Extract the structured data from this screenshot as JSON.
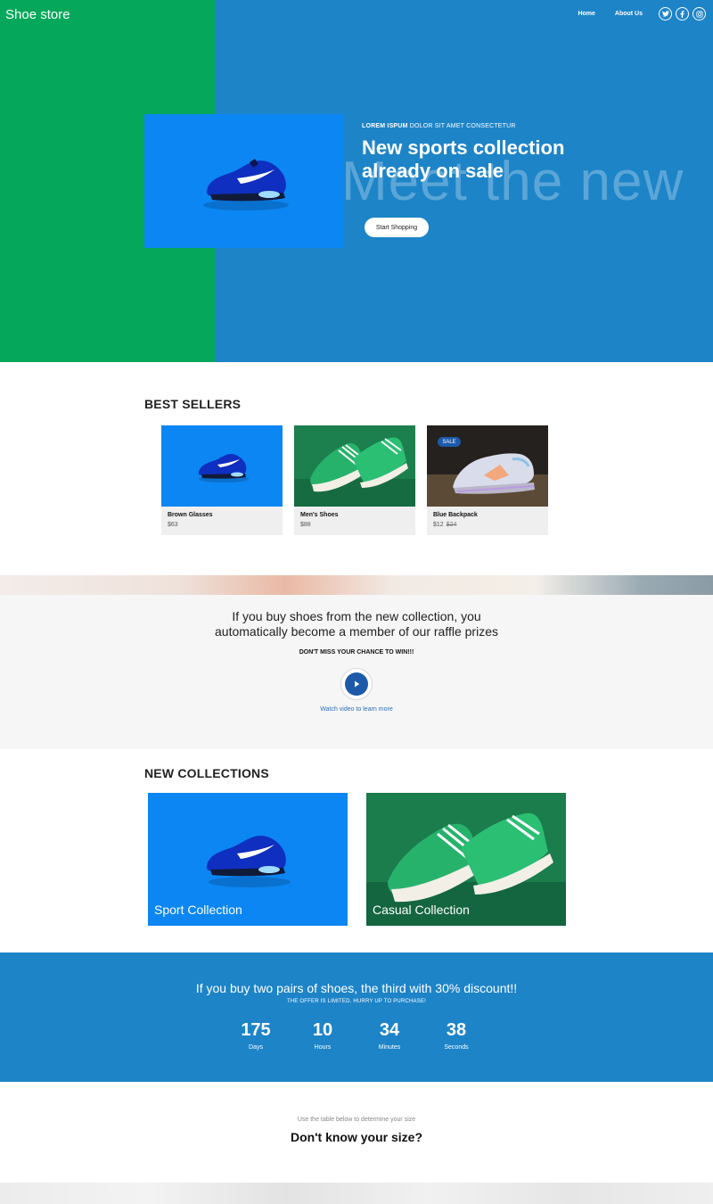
{
  "header": {
    "brand": "Shoe store",
    "nav": [
      "Home",
      "About Us"
    ],
    "social_icons": [
      "twitter-icon",
      "facebook-icon",
      "instagram-icon"
    ]
  },
  "hero": {
    "eyebrow_bold": "LOREM ISPUM",
    "eyebrow_rest": "DOLOR SIT AMET CONSECTETUR",
    "title": "New sports collection already on sale",
    "background_word": "Meet the new",
    "button": "Start Shopping"
  },
  "best_sellers": {
    "title": "BEST SELLERS",
    "items": [
      {
        "name": "Brown Glasses",
        "price": "$63",
        "old_price": "",
        "badge": ""
      },
      {
        "name": "Men's Shoes",
        "price": "$88",
        "old_price": "",
        "badge": ""
      },
      {
        "name": "Blue Backpack",
        "price": "$12",
        "old_price": "$24",
        "badge": "SALE"
      }
    ]
  },
  "raffle": {
    "text_line1": "If you buy shoes from the new collection, you",
    "text_line2": "automatically become a member of our raffle prizes",
    "sub": "DON'T MISS YOUR CHANCE TO WIN!!!",
    "link": "Watch video to learn more"
  },
  "new_collections": {
    "title": "NEW COLLECTIONS",
    "items": [
      {
        "label": "Sport Collection"
      },
      {
        "label": "Casual Collection"
      }
    ]
  },
  "discount": {
    "title": "If you buy two pairs of shoes, the third with 30% discount!!",
    "sub": "THE OFFER IS LIMITED. HURRY UP TO PURCHASE!",
    "countdown": [
      {
        "value": "175",
        "label": "Days"
      },
      {
        "value": "10",
        "label": "Hours"
      },
      {
        "value": "34",
        "label": "Minutes"
      },
      {
        "value": "38",
        "label": "Seconds"
      }
    ]
  },
  "size": {
    "sub": "Use the table below to determine your size",
    "title": "Don't know your size?"
  },
  "colors": {
    "green": "#05a85a",
    "blue": "#1d84c8",
    "bright_blue": "#0b86f2",
    "badge_blue": "#1c5aa9"
  }
}
